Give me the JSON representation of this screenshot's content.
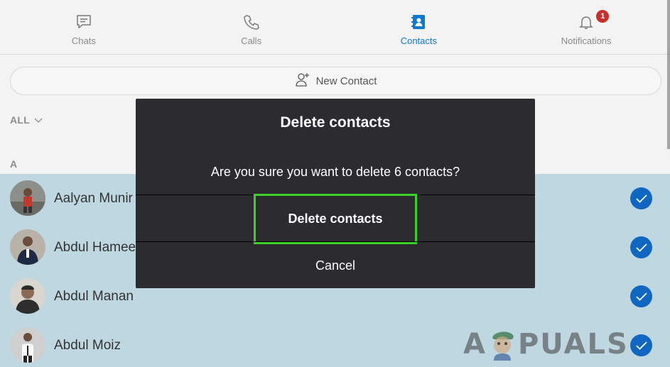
{
  "tabs": [
    {
      "label": "Chats",
      "icon": "chat-icon",
      "active": false
    },
    {
      "label": "Calls",
      "icon": "phone-icon",
      "active": false
    },
    {
      "label": "Contacts",
      "icon": "contacts-icon",
      "active": true
    },
    {
      "label": "Notifications",
      "icon": "bell-icon",
      "active": false,
      "badge": "1"
    }
  ],
  "new_contact": {
    "label": "New Contact",
    "icon": "add-person-icon"
  },
  "filter": {
    "label": "ALL",
    "icon": "chevron-down-icon"
  },
  "section_letter": "A",
  "contacts": [
    {
      "name": "Aalyan Munir",
      "selected": true
    },
    {
      "name": "Abdul Hameed",
      "selected": true
    },
    {
      "name": "Abdul Manan",
      "selected": true
    },
    {
      "name": "Abdul Moiz",
      "selected": true
    }
  ],
  "dialog": {
    "title": "Delete contacts",
    "message": "Are you sure you want to delete 6 contacts?",
    "confirm_label": "Delete contacts",
    "cancel_label": "Cancel"
  },
  "watermark": {
    "text_left": "A",
    "text_right": "PUALS"
  },
  "colors": {
    "accent": "#0f78d4",
    "check": "#0f67c2",
    "badge": "#c9302c",
    "dialog_bg": "#2b2b30",
    "highlight": "#3cd12a",
    "selected_row_bg": "#bfd7e1"
  }
}
